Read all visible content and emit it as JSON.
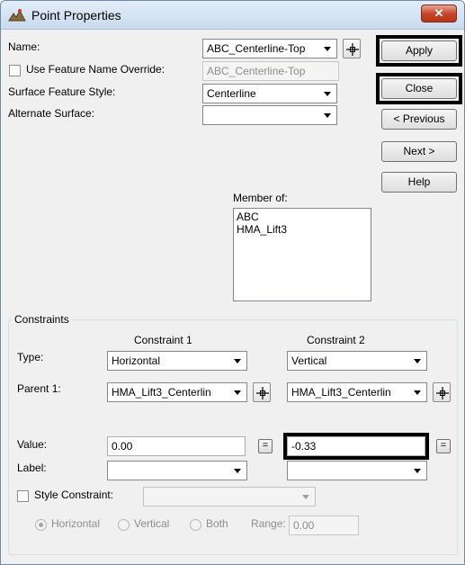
{
  "window": {
    "title": "Point Properties",
    "close_glyph": "✕"
  },
  "fields": {
    "name_label": "Name:",
    "name_value": "ABC_Centerline-Top",
    "override_label": "Use Feature Name Override:",
    "override_value": "ABC_Centerline-Top",
    "surface_style_label": "Surface Feature Style:",
    "surface_style_value": "Centerline",
    "alternate_surface_label": "Alternate Surface:",
    "alternate_surface_value": ""
  },
  "buttons": {
    "apply": "Apply",
    "close": "Close",
    "previous": "< Previous",
    "next": "Next >",
    "help": "Help"
  },
  "member_of": {
    "label": "Member of:",
    "items": [
      "ABC",
      "HMA_Lift3"
    ]
  },
  "constraints": {
    "group_title": "Constraints",
    "col1": "Constraint 1",
    "col2": "Constraint 2",
    "type_label": "Type:",
    "parent_label": "Parent 1:",
    "value_label": "Value:",
    "label_label": "Label:",
    "c1": {
      "type": "Horizontal",
      "parent": "HMA_Lift3_Centerlin",
      "value": "0.00",
      "label": ""
    },
    "c2": {
      "type": "Vertical",
      "parent": "HMA_Lift3_Centerlin",
      "value": "-0.33",
      "label": ""
    },
    "equals_glyph": "=",
    "style_constraint_label": "Style Constraint:",
    "style_constraint_value": "",
    "radio_horizontal": "Horizontal",
    "radio_vertical": "Vertical",
    "radio_both": "Both",
    "range_label": "Range:",
    "range_value": "0.00"
  },
  "icons": {
    "pick": "crosshair-pick-icon",
    "app": "point-properties-app-icon"
  },
  "colors": {
    "highlight": "#000000",
    "title_bg": "#d6e3f2",
    "close_btn": "#c8462c"
  }
}
